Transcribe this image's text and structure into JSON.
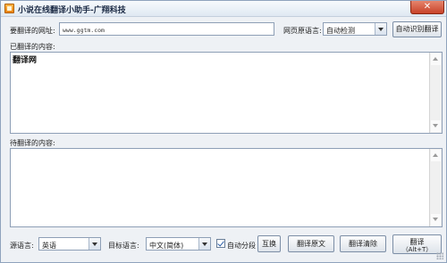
{
  "window": {
    "title": "小说在线翻译小助手-广翔科技",
    "close_glyph": "✕"
  },
  "top": {
    "url_label": "要翻译的网址:",
    "url_value": "www.ggtm.com",
    "page_lang_label": "网页原语言:",
    "page_lang_value": "自动检测",
    "auto_translate_btn": "自动识别翻译"
  },
  "translated": {
    "label": "已翻译的内容:",
    "content": "翻译网"
  },
  "pending": {
    "label": "待翻译的内容:",
    "content": ""
  },
  "bottom": {
    "source_label": "源语言:",
    "source_value": "英语",
    "target_label": "目标语言:",
    "target_value": "中文(简体)",
    "auto_wrap_label": "自动分段",
    "swap_btn": "互换",
    "translate_text_btn": "翻译原文",
    "clear_btn": "翻译清除",
    "translate_btn_line1": "翻译",
    "translate_btn_line2": "（Alt+T）"
  },
  "colors": {
    "accent": "#2a5ea8",
    "close": "#c8432a",
    "frame": "#8fa3bd"
  }
}
